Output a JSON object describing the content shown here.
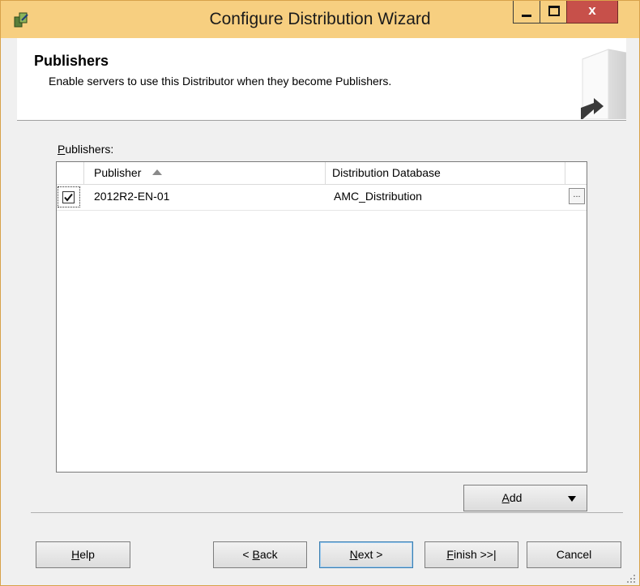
{
  "window": {
    "title": "Configure Distribution Wizard",
    "close_glyph": "x"
  },
  "header": {
    "title": "Publishers",
    "subtitle": "Enable servers to use this Distributor when they become Publishers."
  },
  "publishers": {
    "label_hotkey": "P",
    "label_rest": "ublishers:",
    "columns": {
      "publisher": "Publisher",
      "distribution_db": "Distribution Database"
    },
    "sort": {
      "column": "Publisher",
      "direction": "ascending"
    },
    "rows": [
      {
        "checked": true,
        "publisher": "2012R2-EN-01",
        "distribution_db": "AMC_Distribution",
        "browse_label": "..."
      }
    ]
  },
  "buttons": {
    "add": {
      "hotkey": "A",
      "rest": "dd"
    },
    "help": {
      "hotkey": "H",
      "rest": "elp"
    },
    "back": {
      "pre": "< ",
      "hotkey": "B",
      "rest": "ack"
    },
    "next": {
      "hotkey": "N",
      "rest": "ext >"
    },
    "finish": {
      "hotkey": "F",
      "rest": "inish >>|"
    },
    "cancel": {
      "label": "Cancel"
    }
  },
  "icons": {
    "app": "wizard-icon",
    "minimize": "minimize-icon",
    "maximize": "maximize-icon",
    "close": "close-icon",
    "header_art": "server-arrow-icon",
    "sort": "sort-ascending-icon",
    "checkbox": "checkbox-checked-icon",
    "add_dropdown": "dropdown-caret-icon",
    "grip": "resize-grip-icon"
  },
  "colors": {
    "titlebar": "#f7cf80",
    "close_button": "#c7504a",
    "window_background": "#f0f0f0",
    "header_background": "#ffffff",
    "default_button_border": "#3c7fb1"
  }
}
